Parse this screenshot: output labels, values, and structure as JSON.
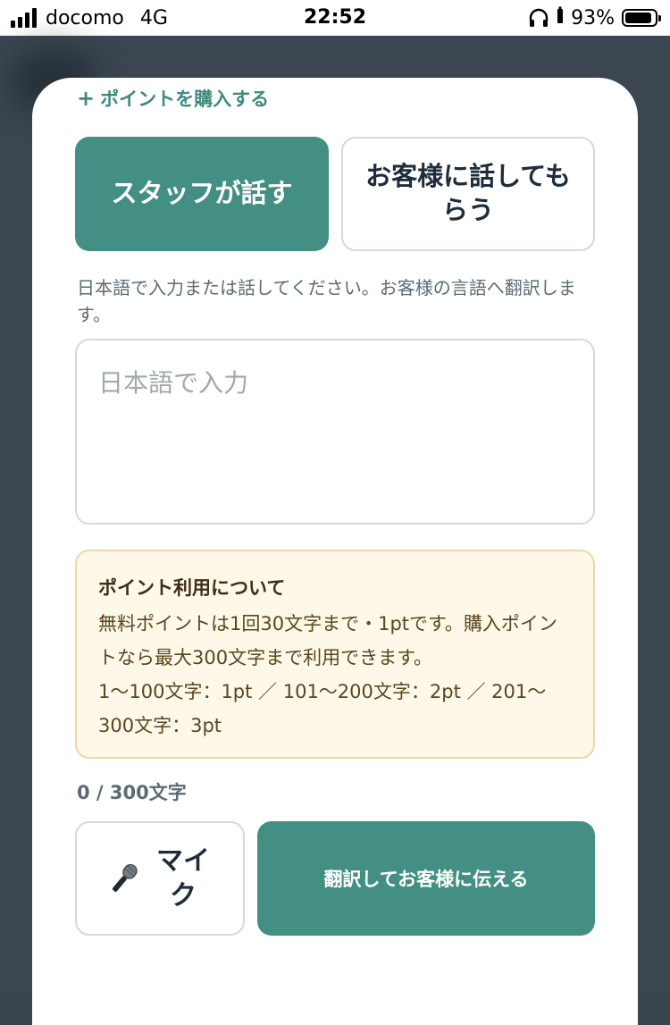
{
  "status_bar": {
    "carrier": "docomo",
    "network": "4G",
    "time": "22:52",
    "battery": "93%"
  },
  "buy_points": {
    "icon": "plus-icon",
    "label": "ポイントを購入する"
  },
  "mode_toggle": {
    "staff_label": "スタッフが話す",
    "customer_label": "お客様に話してもらう",
    "selected": "staff"
  },
  "instruction": "日本語で入力または話してください。お客様の言語へ翻訳します。",
  "text_input": {
    "value": "",
    "placeholder": "日本語で入力"
  },
  "points_notice": {
    "title": "ポイント利用について",
    "lines": [
      "無料ポイントは1回30文字まで・1ptです。購入ポイントなら最大300文字まで利用できます。",
      "1〜100文字：1pt ／ 101〜200文字：2pt ／ 201〜300文字：3pt"
    ]
  },
  "char_counter": "0 / 300文字",
  "actions": {
    "mic_icon": "microphone-icon",
    "mic_label": "マイク",
    "translate_label": "翻訳してお客様に伝える"
  },
  "colors": {
    "primary": "#448f83",
    "link": "#3e8a7f",
    "notice_bg": "#fef8e8",
    "notice_border": "#ecd9a4"
  }
}
